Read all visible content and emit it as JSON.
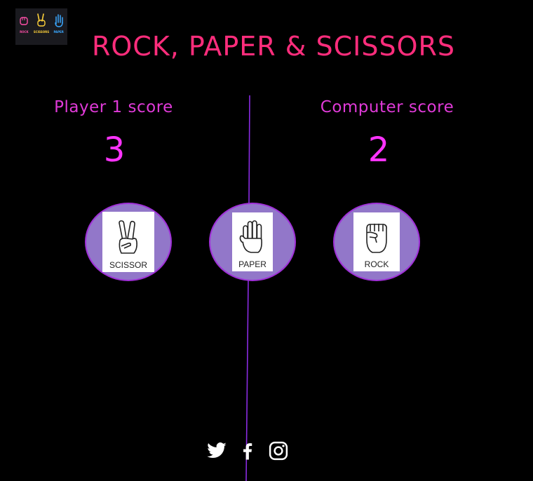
{
  "logo": {
    "items": [
      {
        "label": "ROCK",
        "color": "#ff4fa8"
      },
      {
        "label": "SCISSORS",
        "color": "#ffd23a"
      },
      {
        "label": "PAPER",
        "color": "#3aa8ff"
      }
    ]
  },
  "header": {
    "title": "ROCK, PAPER & SCISSORS",
    "title_color": "#ff2d7c"
  },
  "scores": {
    "player_label": "Player 1 score",
    "player_value": "3",
    "computer_label": "Computer score",
    "computer_value": "2"
  },
  "choices": [
    {
      "label": "SCISSOR",
      "icon": "scissor-hand-icon"
    },
    {
      "label": "PAPER",
      "icon": "paper-hand-icon"
    },
    {
      "label": "ROCK",
      "icon": "rock-fist-icon"
    }
  ],
  "social": [
    "twitter-icon",
    "facebook-icon",
    "instagram-icon"
  ],
  "colors": {
    "background": "#000000",
    "accent": "#ff2d7c",
    "score_label": "#e03ad8",
    "score_value": "#ff33ff",
    "choice_fill": "#9277c9",
    "divider": "#8a2be2"
  }
}
